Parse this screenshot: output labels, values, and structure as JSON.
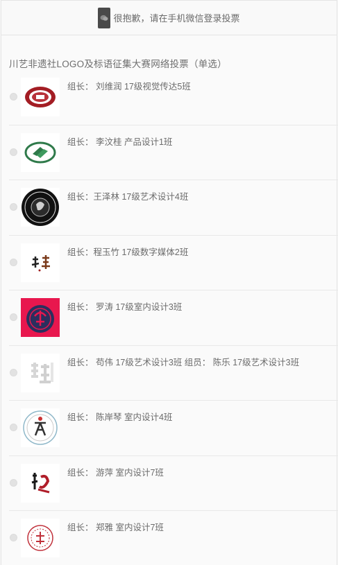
{
  "notice": {
    "icon": "wechat-icon",
    "text": "很抱歉，请在手机微信登录投票"
  },
  "poll": {
    "title": "川艺非遗社LOGO及标语征集大赛网络投票（单选）",
    "options": [
      {
        "label": "组长：  刘维润 17级视觉传达5班",
        "logo": "red-oval-seal-logo"
      },
      {
        "label": "组长：  李汶桂 产品设计1班",
        "logo": "green-swirl-logo"
      },
      {
        "label": "组长：王泽林 17级艺术设计4班",
        "logo": "black-circle-badge-logo"
      },
      {
        "label": "组长：程玉竹 17级数字媒体2班",
        "logo": "calligraphy-logo"
      },
      {
        "label": "组长：  罗涛 17级室内设计3班",
        "logo": "crimson-tree-logo"
      },
      {
        "label": "组长：  苟伟 17级艺术设计3班 组员：  陈乐 17级艺术设计3班",
        "logo": "outline-character-logo"
      },
      {
        "label": "组长：  陈岸琴 室内设计4班",
        "logo": "circle-figure-logo"
      },
      {
        "label": "组长：  游萍 室内设计7班",
        "logo": "red-calligraphy-logo"
      },
      {
        "label": "组长：  郑雅 室内设计7班",
        "logo": "red-round-seal-logo"
      }
    ]
  }
}
